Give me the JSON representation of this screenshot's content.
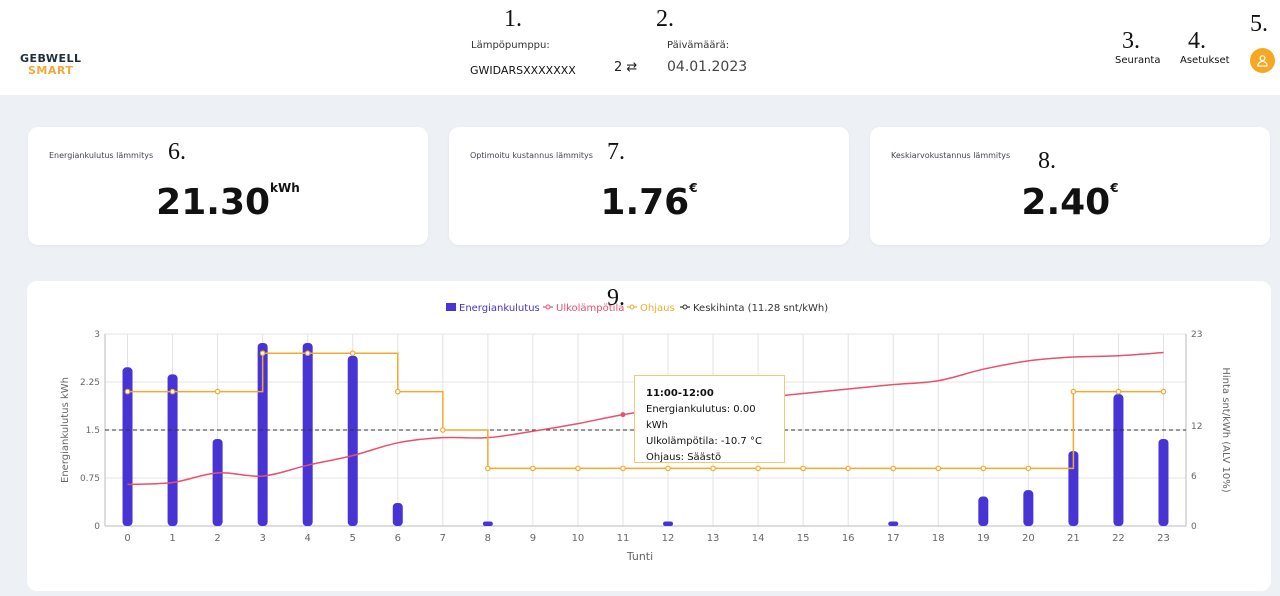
{
  "header": {
    "logo_top": "GEBWELL",
    "logo_bottom": "SMART",
    "heatpump_label": "Lämpöpumppu:",
    "heatpump_value": "GWIDARSXXXXXXX",
    "swap_count": "2",
    "swap_icon": "⇄",
    "date_label": "Päivämäärä:",
    "date_value": "04.01.2023",
    "nav_monitoring": "Seuranta",
    "nav_settings": "Asetukset"
  },
  "annotations": [
    "1.",
    "2.",
    "3.",
    "4.",
    "5.",
    "6.",
    "7.",
    "8.",
    "9."
  ],
  "cards": [
    {
      "label": "Energiankulutus lämmitys",
      "value": "21.30",
      "unit": "kWh"
    },
    {
      "label": "Optimoitu kustannus lämmitys",
      "value": "1.76",
      "unit": "€"
    },
    {
      "label": "Keskiarvokustannus lämmitys",
      "value": "2.40",
      "unit": "€"
    }
  ],
  "tooltip": {
    "title": "11:00-12:00",
    "energy": "Energiankulutus: 0.00 kWh",
    "temp": "Ulkolämpötila: -10.7 °C",
    "mode": "Ohjaus: Säästö"
  },
  "colors": {
    "energy": "#4834d4",
    "temp": "#e8506e",
    "control": "#f3a92d",
    "avg": "#333333",
    "accent": "#f7a823"
  },
  "chart_data": {
    "type": "bar",
    "legend": [
      "Energiankulutus",
      "Ulkolämpötila",
      "Ohjaus",
      "Keskihinta (11.28 snt/kWh)"
    ],
    "xlabel": "Tunti",
    "ylabel_left": "Energiankulutus kWh",
    "ylabel_right": "Hinta snt/kWh (ALV 10%)",
    "categories": [
      "0",
      "1",
      "2",
      "3",
      "4",
      "5",
      "6",
      "7",
      "8",
      "9",
      "10",
      "11",
      "12",
      "13",
      "14",
      "15",
      "16",
      "17",
      "18",
      "19",
      "20",
      "21",
      "22",
      "23"
    ],
    "y_left_ticks": [
      "0",
      "0.75",
      "1.5",
      "2.25",
      "3"
    ],
    "y_right_ticks": [
      "0",
      "6",
      "12",
      "23"
    ],
    "ylim_left": [
      0,
      3
    ],
    "ylim_right": [
      0,
      23
    ],
    "series": [
      {
        "name": "Energiankulutus",
        "type": "bar",
        "axis": "left",
        "values": [
          2.48,
          2.37,
          1.36,
          2.86,
          2.86,
          2.66,
          0.36,
          0,
          0.07,
          0,
          0,
          0,
          0.07,
          0,
          0,
          0,
          0,
          0.07,
          0,
          0.46,
          0.56,
          1.17,
          2.06,
          1.36
        ]
      },
      {
        "name": "Ulkolämpötila",
        "type": "line",
        "axis": "left",
        "values": [
          0.65,
          0.68,
          0.83,
          0.78,
          0.95,
          1.1,
          1.3,
          1.38,
          1.38,
          1.48,
          1.6,
          1.74,
          1.84,
          1.94,
          2.0,
          2.07,
          2.14,
          2.21,
          2.27,
          2.45,
          2.58,
          2.64,
          2.66,
          2.71
        ]
      },
      {
        "name": "Ohjaus",
        "type": "step",
        "axis": "left",
        "values": [
          2.1,
          2.1,
          2.1,
          2.7,
          2.7,
          2.7,
          2.1,
          1.5,
          0.9,
          0.9,
          0.9,
          0.9,
          0.9,
          0.9,
          0.9,
          0.9,
          0.9,
          0.9,
          0.9,
          0.9,
          0.9,
          2.1,
          2.1,
          2.1
        ]
      },
      {
        "name": "Keskihinta (11.28 snt/kWh)",
        "type": "hline",
        "axis": "left",
        "value": 1.5
      }
    ],
    "grid": true,
    "legend_position": "top"
  }
}
